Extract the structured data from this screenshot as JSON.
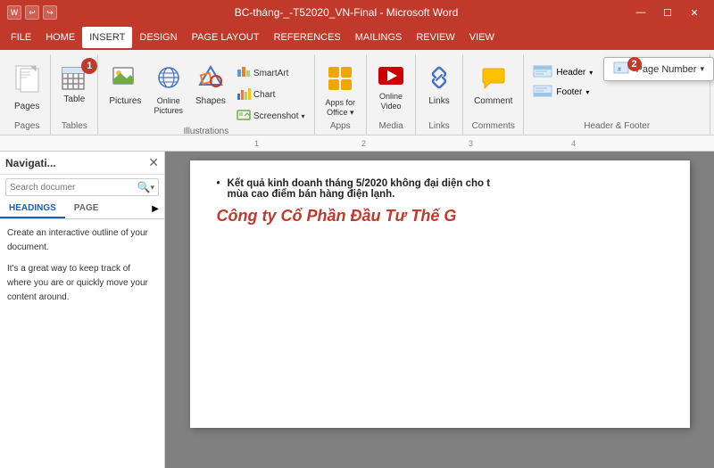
{
  "titleBar": {
    "title": "BC-tháng-_-T52020_VN-Final - Microsoft Word",
    "icons": [
      "⊞",
      "↩",
      "↪"
    ],
    "controls": [
      "—",
      "☐",
      "✕"
    ]
  },
  "menuBar": {
    "items": [
      "FILE",
      "HOME",
      "INSERT",
      "DESIGN",
      "PAGE LAYOUT",
      "REFERENCES",
      "MAILINGS",
      "REVIEW",
      "VIEW"
    ],
    "activeItem": "INSERT"
  },
  "ribbon": {
    "groups": [
      {
        "name": "Pages",
        "label": "Pages",
        "buttons": [
          {
            "id": "pages",
            "label": "Pages"
          }
        ]
      },
      {
        "name": "Tables",
        "label": "Tables",
        "buttons": [
          {
            "id": "table",
            "label": "Table"
          }
        ]
      },
      {
        "name": "Illustrations",
        "label": "Illustrations",
        "buttons": [
          {
            "id": "pictures",
            "label": "Pictures"
          },
          {
            "id": "online-pictures",
            "label": "Online Pictures"
          },
          {
            "id": "shapes",
            "label": "Shapes"
          },
          {
            "id": "smartart",
            "label": "SmartArt"
          },
          {
            "id": "chart",
            "label": "Chart"
          },
          {
            "id": "screenshot",
            "label": "Screenshot"
          }
        ]
      },
      {
        "name": "Apps",
        "label": "Apps",
        "buttons": [
          {
            "id": "apps-for-office",
            "label": "Apps for Office",
            "sublabel": "Apps"
          }
        ]
      },
      {
        "name": "Media",
        "label": "Media",
        "buttons": [
          {
            "id": "online-video",
            "label": "Online Video"
          }
        ]
      },
      {
        "name": "Links",
        "label": "Links",
        "buttons": [
          {
            "id": "links",
            "label": "Links"
          }
        ]
      },
      {
        "name": "Comments",
        "label": "Comments",
        "buttons": [
          {
            "id": "comment",
            "label": "Comment"
          }
        ]
      },
      {
        "name": "HeaderFooter",
        "label": "Header & Footer",
        "buttons": [
          {
            "id": "header",
            "label": "Header"
          },
          {
            "id": "footer",
            "label": "Footer"
          },
          {
            "id": "page-number",
            "label": "Page Number"
          }
        ]
      }
    ],
    "badges": {
      "table": "1",
      "page-number": "2"
    }
  },
  "navPanel": {
    "title": "Navigati...",
    "closeBtn": "✕",
    "searchPlaceholder": "Search documer",
    "tabs": [
      "HEADINGS",
      "PAGE"
    ],
    "activeTab": "HEADINGS",
    "body": [
      "Create an interactive outline of your document.",
      "It's a great way to keep track of where you are or quickly move your content around."
    ]
  },
  "document": {
    "bullets": [
      "Kết quả kinh doanh tháng 5/2020 không đại diện cho t mùa cao điểm bán hàng điện lạnh."
    ],
    "title": "Công ty Cổ Phần Đầu Tư Thế G"
  },
  "ruler": {
    "marks": [
      "1",
      "2",
      "3",
      "4"
    ]
  }
}
